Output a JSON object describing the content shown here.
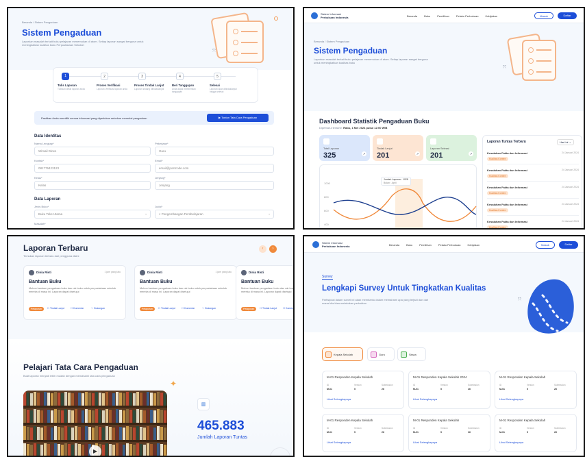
{
  "p1": {
    "breadcrumb": "Beranda / Sistem Pengaduan",
    "title": "Sistem Pengaduan",
    "desc": "Laporkan masalah terkait buku pelajaran menemukan di atom. Setiap laporan sangat berguna untuk meningkatkan kualitas buku Perpustakaan Sekolah",
    "steps": [
      {
        "num": "1",
        "label": "Tulis Laporan",
        "sub": "Tuliskan detail laporan anda"
      },
      {
        "num": "2",
        "label": "Proses Verifikasi",
        "sub": "Laporan Verifikasi laporan anda"
      },
      {
        "num": "3",
        "label": "Proses Tindak Lanjut",
        "sub": "Laporan sedang ditindaklanjuti"
      },
      {
        "num": "4",
        "label": "Beri Tanggapan",
        "sub": "Anda dapat memberikan tanggapan"
      },
      {
        "num": "5",
        "label": "Selesai",
        "sub": "Laporan akan ditindaklanjuti hingga selesai"
      }
    ],
    "notice": "Pastikan Anda memiliki semua informasi yang diperlukan sebelum memulai pengaduan",
    "notice_btn": "Tonton Tata Cara Pengaduan",
    "sec_identitas": "Data Identitas",
    "fields": [
      {
        "label": "Nama Lengkap*",
        "value": "Wimail Dines"
      },
      {
        "label": "Pekerjaan*",
        "value": "Guru"
      },
      {
        "label": "Kontak*",
        "value": "081776423123"
      },
      {
        "label": "Email*",
        "value": "email@postcode.com"
      },
      {
        "label": "Kelas*",
        "value": "Kelas"
      },
      {
        "label": "Jenjang*",
        "value": "Jenjang"
      }
    ],
    "sec_laporan": "Data Laporan",
    "jenis_label": "Jenis Buku*",
    "jenis_value": "Buku Teks Utama",
    "judul_label": "Judul*",
    "judul_value": "Pengembangan Pembelajaran",
    "masalah_label": "Masalah*"
  },
  "p2": {
    "brand_top": "Sistem Informasi",
    "brand_bottom": "Perbukuan Indonesia",
    "nav": [
      "Beranda",
      "Buku",
      "Pemilihan",
      "Pelaku Perbukuan",
      "Kebijakan"
    ],
    "login": "Masuk",
    "register": "Daftar",
    "breadcrumb": "Beranda / Sistem Pengaduan",
    "title": "Sistem Pengaduan",
    "desc": "Laporkan masalah terkait buku pelajaran menemukan di atom. Setiap laporan sangat berguna untuk meningkatkan kualitas buku",
    "dash_title": "Dashboard Statistik Pengaduan Buku",
    "dash_sub_prefix": "Diperbarui terakhir: ",
    "dash_sub_date": "Rabu, 1 Mei 2024 pukul 12:00 WIB",
    "stats": [
      {
        "label": "Total Laporan",
        "value": "325",
        "color": "#dbe7fb"
      },
      {
        "label": "Tindak Lanjut",
        "value": "201",
        "color": "#fde5d3"
      },
      {
        "label": "Laporan Selesai",
        "value": "201",
        "color": "#dcf2de"
      }
    ],
    "chart_tooltip_title": "Jumlah Laporan : 1028",
    "chart_tooltip_sub": "Bulan : April",
    "y_ticks": [
      "1000",
      "800",
      "600",
      "400"
    ],
    "side_title": "Laporan Tuntas Terbaru",
    "side_filter": "Hari ini",
    "side_items": [
      {
        "title": "Kesalahan Fakta dan Informasi",
        "date": "24 Januari 2024",
        "tag": "Kualitas Konten"
      },
      {
        "title": "Kesalahan Fakta dan Informasi",
        "date": "24 Januari 2024",
        "tag": "Kualitas Konten"
      },
      {
        "title": "Kesalahan Fakta dan Informasi",
        "date": "24 Januari 2024",
        "tag": "Kualitas Konten"
      },
      {
        "title": "Kesalahan Fakta dan Informasi",
        "date": "24 Januari 2024",
        "tag": "Kualitas Konten"
      },
      {
        "title": "Kesalahan Fakta dan Informasi",
        "date": "24 Januari 2024",
        "tag": "Kualitas Konten"
      }
    ]
  },
  "p3": {
    "title": "Laporan Terbaru",
    "sub": "Temukan laporan terbaru dari pengguna disini",
    "cards": [
      {
        "user": "Dinia Risti",
        "time": "1 jam yang lalu",
        "title": "Bantuan Buku",
        "body": "Mohon bantuan pengadaan buku dan rak buku untuk perpustakaan sekolah mereka di masa ini. Laporan dapat disetujui",
        "tag": "Pelaporan",
        "a1": "Tindak Lanjut",
        "a2": "Komentar",
        "a3": "Dukungan"
      },
      {
        "user": "Dinia Risti",
        "time": "1 jam yang lalu",
        "title": "Bantuan Buku",
        "body": "Mohon bantuan pengadaan buku dan rak buku untuk perpustakaan sekolah mereka di masa ini. Laporan dapat disetujui",
        "tag": "Pelaporan",
        "a1": "Tindak Lanjut",
        "a2": "Komentar",
        "a3": "Dukungan"
      },
      {
        "user": "Dinia Risti",
        "time": "1 jam yang lalu",
        "title": "Bantuan Buku",
        "body": "Mohon bantuan pengadaan buku dan rak buku untuk perpustakaan sekolah mereka di masa ini. Laporan dapat disetujui",
        "tag": "Pelaporan",
        "a1": "Tindak Lanjut",
        "a2": "Komentar",
        "a3": "Dukungan"
      }
    ],
    "learn_title": "Pelajari Tata Cara Pengaduan",
    "learn_sub": "Buat laporan menjadi lebih mudah dengan memahami tata cara pengaduan",
    "count": "465.883",
    "count_label": "Jumlah Laporan Tuntas"
  },
  "p4": {
    "brand_top": "Sistem Informasi",
    "brand_bottom": "Perbukuan Indonesia",
    "nav": [
      "Beranda",
      "Buku",
      "Pemilihan",
      "Pelaku Perbukuan",
      "Kebijakan"
    ],
    "login": "Masuk",
    "register": "Daftar",
    "eyebrow": "Survey",
    "title": "Lengkapi Survey Untuk Tingkatkan Kualitas",
    "desc": "Partisipasi dalam survei ini akan membantu dalam memahami apa yang terjadi dan dari mana kita bisa melakukan perbaikan",
    "tabs": [
      "Kepala Sekolah",
      "Guru",
      "Siswa"
    ],
    "surveys": [
      {
        "title": "M-01 Responden Kepala Sekolah",
        "c1": "ID",
        "c2": "Version",
        "c3": "Submission",
        "v1": "M-01",
        "v2": "5",
        "v3": "26",
        "link": "Lihat Selengkapnya"
      },
      {
        "title": "M-01 Responden Kepala Sekolah 2024",
        "c1": "ID",
        "c2": "Version",
        "c3": "Submission",
        "v1": "M-01",
        "v2": "5",
        "v3": "26",
        "link": "Lihat Selengkapnya"
      },
      {
        "title": "M-01 Responden Kepala Sekolah",
        "c1": "ID",
        "c2": "Version",
        "c3": "Submission",
        "v1": "M-01",
        "v2": "5",
        "v3": "26",
        "link": "Lihat Selengkapnya"
      },
      {
        "title": "M-01 Responden Kepala Sekolah",
        "c1": "ID",
        "c2": "Version",
        "c3": "Submission",
        "v1": "M-01",
        "v2": "5",
        "v3": "26",
        "link": "Lihat Selengkapnya"
      },
      {
        "title": "M-01 Responden Kepala Sekolah",
        "c1": "ID",
        "c2": "Version",
        "c3": "Submission",
        "v1": "M-01",
        "v2": "5",
        "v3": "26",
        "link": "Lihat Selengkapnya"
      },
      {
        "title": "M-01 Responden Kepala Sekolah",
        "c1": "ID",
        "c2": "Version",
        "c3": "Submission",
        "v1": "M-01",
        "v2": "5",
        "v3": "26",
        "link": "Lihat Selengkapnya"
      }
    ]
  }
}
